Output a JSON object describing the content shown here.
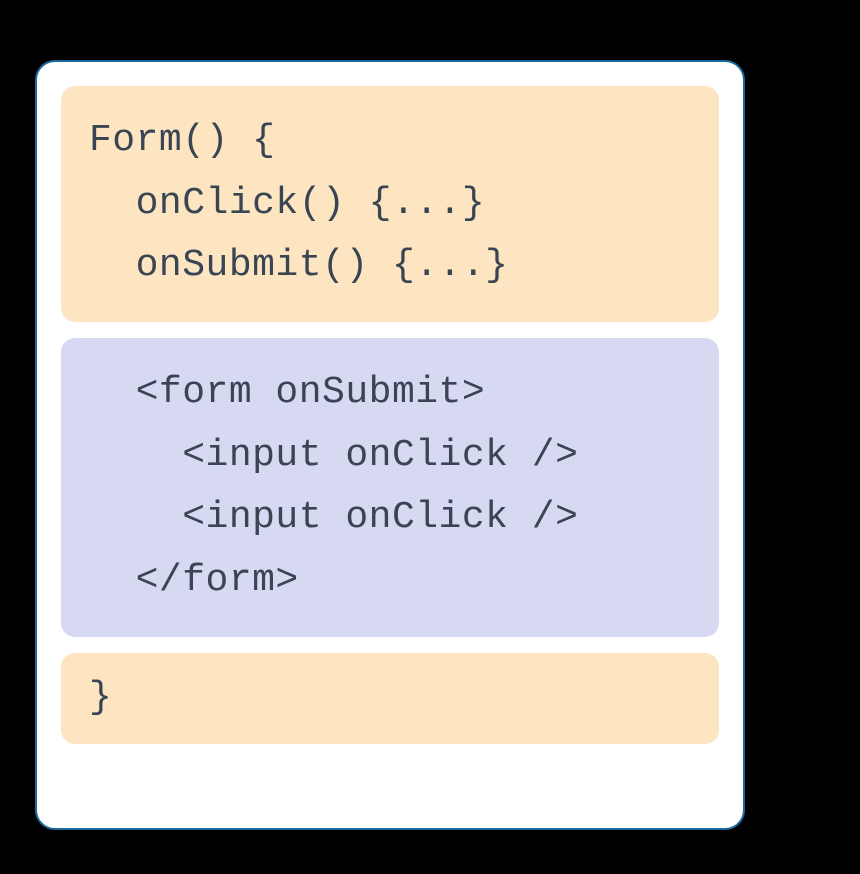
{
  "topBlock": {
    "line1": "Form() {",
    "line2": "  onClick() {...}",
    "line3": "  onSubmit() {...}"
  },
  "middleBlock": {
    "line1": "  <form onSubmit>",
    "line2": "    <input onClick />",
    "line3": "    <input onClick />",
    "line4": "  </form>"
  },
  "bottomBlock": {
    "line1": "}"
  },
  "colors": {
    "orange": "#fce5c0",
    "purple": "#d7d9f2",
    "border": "#1a6a9b",
    "text": "#3a4554"
  }
}
